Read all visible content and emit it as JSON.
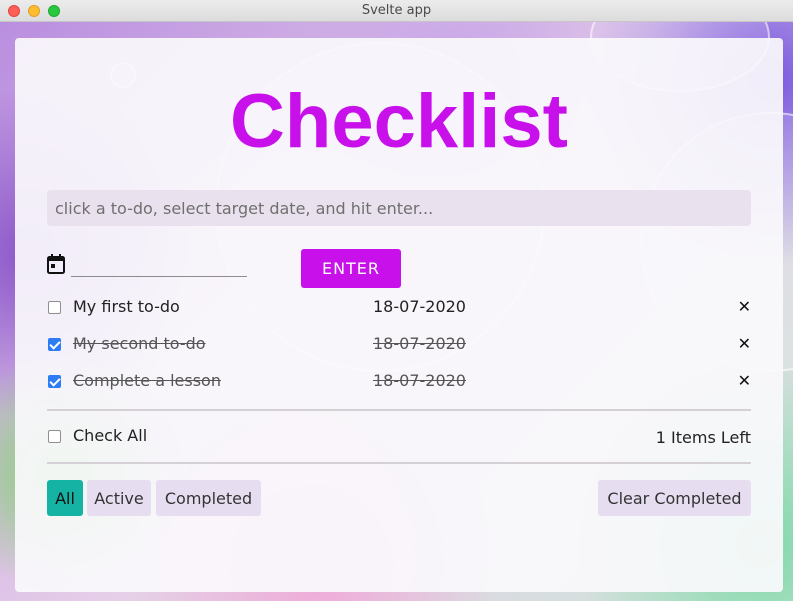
{
  "window": {
    "title": "Svelte app"
  },
  "app": {
    "heading": "Checklist",
    "input_placeholder": "click a to-do, select target date, and hit enter...",
    "enter_label": "ENTER"
  },
  "todos": [
    {
      "text": "My first to-do",
      "date": "18-07-2020",
      "done": false
    },
    {
      "text": "My second to-do",
      "date": "18-07-2020",
      "done": true
    },
    {
      "text": "Complete a lesson",
      "date": "18-07-2020",
      "done": true
    }
  ],
  "footer": {
    "check_all_label": "Check All",
    "items_left": "1 Items Left",
    "filters": [
      "All",
      "Active",
      "Completed"
    ],
    "active_filter": "All",
    "clear_label": "Clear Completed"
  },
  "icons": {
    "calendar": "calendar-icon",
    "delete": "close-icon"
  },
  "colors": {
    "accent": "#c811ea",
    "filter_active": "#14b3a4",
    "checkbox_checked": "#2c7cf6"
  }
}
